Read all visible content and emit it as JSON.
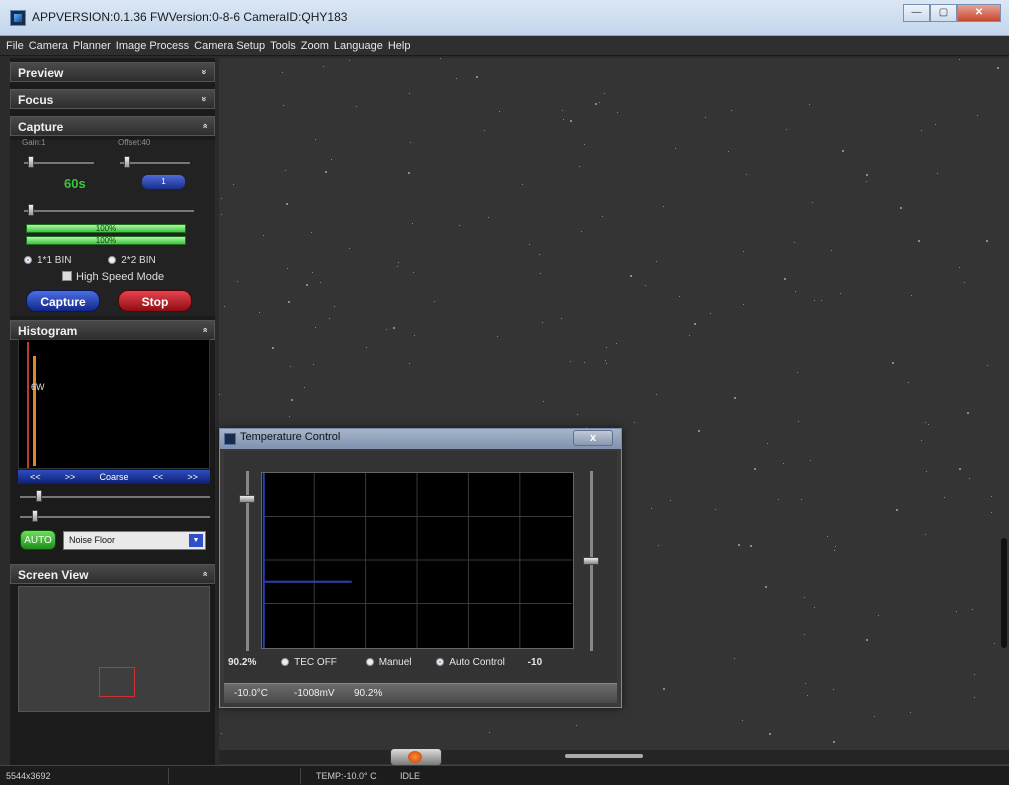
{
  "window": {
    "title": "APPVERSION:0.1.36  FWVersion:0-8-6  CameraID:QHY183",
    "minimize": "—",
    "maximize": "▢",
    "close": "✕"
  },
  "menu": [
    "File",
    "Camera",
    "Planner",
    "Image Process",
    "Camera Setup",
    "Tools",
    "Zoom",
    "Language",
    "Help"
  ],
  "sections": {
    "preview": "Preview",
    "focus": "Focus",
    "capture": "Capture",
    "histogram": "Histogram",
    "screen_view": "Screen View",
    "collapsed_chevron": "»",
    "expanded_chevron": "«"
  },
  "capture": {
    "gain_label": "Gain:1",
    "offset_label": "Offset:40",
    "exposure_value": "60s",
    "count_value": "1",
    "bar1_text": "100%",
    "bar1_level": 1.0,
    "bar2_text": "100%",
    "bar2_level": 1.0,
    "bin1": "1*1 BIN",
    "bin2": "2*2 BIN",
    "high_speed": "High Speed Mode",
    "capture_btn": "Capture",
    "stop_btn": "Stop"
  },
  "histogram": {
    "label": "6W",
    "ctrl_prev": "<<",
    "ctrl_next": ">>",
    "ctrl_coarse": "Coarse",
    "ctrl_prev2": "<<",
    "ctrl_next2": ">>",
    "auto_btn": "AUTO",
    "mode": "Noise Floor"
  },
  "statusbar": {
    "resolution": "5544x3692",
    "temp": "TEMP:-10.0° C",
    "state": "IDLE"
  },
  "temperature_dialog": {
    "title": "Temperature Control",
    "close": "x",
    "left_value": "90.2%",
    "right_value": "-10",
    "opt_tec_off": "TEC OFF",
    "opt_manual": "Manuel",
    "opt_auto": "Auto Control",
    "status_temp": "-10.0°C",
    "status_mv": "-1008mV",
    "status_pwm": "90.2%",
    "pwm_level": 0.902,
    "target_level": 0.5
  },
  "colors": {
    "accent_blue": "#1a2f8c",
    "accent_red": "#8e0c14",
    "accent_green": "#37c93a"
  }
}
